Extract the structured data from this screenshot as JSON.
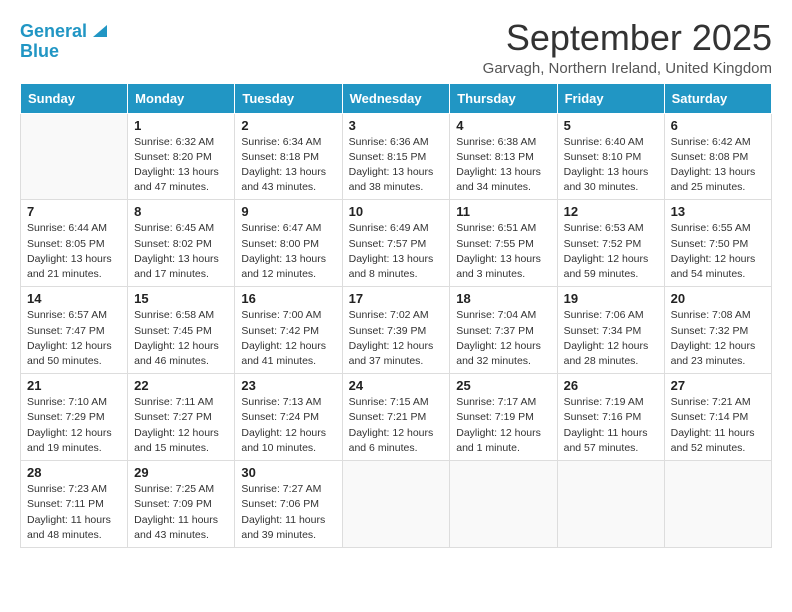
{
  "header": {
    "logo_line1": "General",
    "logo_line2": "Blue",
    "month_title": "September 2025",
    "location": "Garvagh, Northern Ireland, United Kingdom"
  },
  "days_of_week": [
    "Sunday",
    "Monday",
    "Tuesday",
    "Wednesday",
    "Thursday",
    "Friday",
    "Saturday"
  ],
  "weeks": [
    [
      {
        "day": "",
        "info": ""
      },
      {
        "day": "1",
        "info": "Sunrise: 6:32 AM\nSunset: 8:20 PM\nDaylight: 13 hours\nand 47 minutes."
      },
      {
        "day": "2",
        "info": "Sunrise: 6:34 AM\nSunset: 8:18 PM\nDaylight: 13 hours\nand 43 minutes."
      },
      {
        "day": "3",
        "info": "Sunrise: 6:36 AM\nSunset: 8:15 PM\nDaylight: 13 hours\nand 38 minutes."
      },
      {
        "day": "4",
        "info": "Sunrise: 6:38 AM\nSunset: 8:13 PM\nDaylight: 13 hours\nand 34 minutes."
      },
      {
        "day": "5",
        "info": "Sunrise: 6:40 AM\nSunset: 8:10 PM\nDaylight: 13 hours\nand 30 minutes."
      },
      {
        "day": "6",
        "info": "Sunrise: 6:42 AM\nSunset: 8:08 PM\nDaylight: 13 hours\nand 25 minutes."
      }
    ],
    [
      {
        "day": "7",
        "info": "Sunrise: 6:44 AM\nSunset: 8:05 PM\nDaylight: 13 hours\nand 21 minutes."
      },
      {
        "day": "8",
        "info": "Sunrise: 6:45 AM\nSunset: 8:02 PM\nDaylight: 13 hours\nand 17 minutes."
      },
      {
        "day": "9",
        "info": "Sunrise: 6:47 AM\nSunset: 8:00 PM\nDaylight: 13 hours\nand 12 minutes."
      },
      {
        "day": "10",
        "info": "Sunrise: 6:49 AM\nSunset: 7:57 PM\nDaylight: 13 hours\nand 8 minutes."
      },
      {
        "day": "11",
        "info": "Sunrise: 6:51 AM\nSunset: 7:55 PM\nDaylight: 13 hours\nand 3 minutes."
      },
      {
        "day": "12",
        "info": "Sunrise: 6:53 AM\nSunset: 7:52 PM\nDaylight: 12 hours\nand 59 minutes."
      },
      {
        "day": "13",
        "info": "Sunrise: 6:55 AM\nSunset: 7:50 PM\nDaylight: 12 hours\nand 54 minutes."
      }
    ],
    [
      {
        "day": "14",
        "info": "Sunrise: 6:57 AM\nSunset: 7:47 PM\nDaylight: 12 hours\nand 50 minutes."
      },
      {
        "day": "15",
        "info": "Sunrise: 6:58 AM\nSunset: 7:45 PM\nDaylight: 12 hours\nand 46 minutes."
      },
      {
        "day": "16",
        "info": "Sunrise: 7:00 AM\nSunset: 7:42 PM\nDaylight: 12 hours\nand 41 minutes."
      },
      {
        "day": "17",
        "info": "Sunrise: 7:02 AM\nSunset: 7:39 PM\nDaylight: 12 hours\nand 37 minutes."
      },
      {
        "day": "18",
        "info": "Sunrise: 7:04 AM\nSunset: 7:37 PM\nDaylight: 12 hours\nand 32 minutes."
      },
      {
        "day": "19",
        "info": "Sunrise: 7:06 AM\nSunset: 7:34 PM\nDaylight: 12 hours\nand 28 minutes."
      },
      {
        "day": "20",
        "info": "Sunrise: 7:08 AM\nSunset: 7:32 PM\nDaylight: 12 hours\nand 23 minutes."
      }
    ],
    [
      {
        "day": "21",
        "info": "Sunrise: 7:10 AM\nSunset: 7:29 PM\nDaylight: 12 hours\nand 19 minutes."
      },
      {
        "day": "22",
        "info": "Sunrise: 7:11 AM\nSunset: 7:27 PM\nDaylight: 12 hours\nand 15 minutes."
      },
      {
        "day": "23",
        "info": "Sunrise: 7:13 AM\nSunset: 7:24 PM\nDaylight: 12 hours\nand 10 minutes."
      },
      {
        "day": "24",
        "info": "Sunrise: 7:15 AM\nSunset: 7:21 PM\nDaylight: 12 hours\nand 6 minutes."
      },
      {
        "day": "25",
        "info": "Sunrise: 7:17 AM\nSunset: 7:19 PM\nDaylight: 12 hours\nand 1 minute."
      },
      {
        "day": "26",
        "info": "Sunrise: 7:19 AM\nSunset: 7:16 PM\nDaylight: 11 hours\nand 57 minutes."
      },
      {
        "day": "27",
        "info": "Sunrise: 7:21 AM\nSunset: 7:14 PM\nDaylight: 11 hours\nand 52 minutes."
      }
    ],
    [
      {
        "day": "28",
        "info": "Sunrise: 7:23 AM\nSunset: 7:11 PM\nDaylight: 11 hours\nand 48 minutes."
      },
      {
        "day": "29",
        "info": "Sunrise: 7:25 AM\nSunset: 7:09 PM\nDaylight: 11 hours\nand 43 minutes."
      },
      {
        "day": "30",
        "info": "Sunrise: 7:27 AM\nSunset: 7:06 PM\nDaylight: 11 hours\nand 39 minutes."
      },
      {
        "day": "",
        "info": ""
      },
      {
        "day": "",
        "info": ""
      },
      {
        "day": "",
        "info": ""
      },
      {
        "day": "",
        "info": ""
      }
    ]
  ]
}
